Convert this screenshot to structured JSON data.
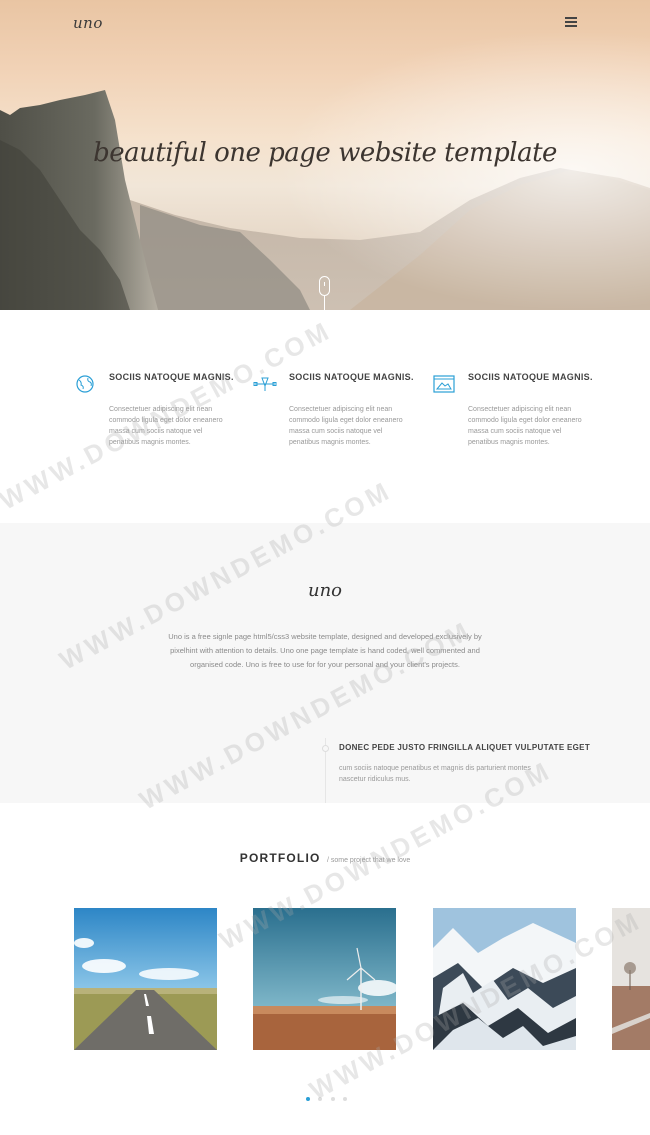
{
  "header": {
    "logo": "uno",
    "menu_icon": "hamburger-menu-icon"
  },
  "hero": {
    "title": "beautiful one page website template",
    "scroll_icon": "mouse-scroll-icon"
  },
  "features": [
    {
      "icon": "globe-icon",
      "title": "SOCIIS NATOQUE MAGNIS.",
      "text": "Consectetuer adipiscing elit nean commodo ligula eget dolor eneanero massa cum sociis natoque vel penatibus magnis montes."
    },
    {
      "icon": "vector-pen-icon",
      "title": "SOCIIS NATOQUE MAGNIS.",
      "text": "Consectetuer adipiscing elit nean commodo ligula eget dolor eneanero massa cum sociis natoque vel penatibus magnis montes."
    },
    {
      "icon": "browser-image-icon",
      "title": "SOCIIS NATOQUE MAGNIS.",
      "text": "Consectetuer adipiscing elit nean commodo ligula eget dolor eneanero massa cum sociis natoque vel penatibus magnis montes."
    }
  ],
  "about": {
    "logo": "uno",
    "text": "Uno is a free signle page html5/css3 website template, designed and developed exclusively by pixelhint with attention to details. Uno one page template is hand coded, well commented and organised code. Uno is free to use for for your personal and your client's projects.",
    "timeline": {
      "title": "DONEC PEDE JUSTO FRINGILLA ALIQUET VULPUTATE EGET",
      "text": "cum sociis natoque penatibus et magnis dis parturient montes nascetur ridiculus mus."
    }
  },
  "portfolio": {
    "title": "PORTFOLIO",
    "subtitle": "/ some project that we love",
    "items": [
      {
        "name": "road"
      },
      {
        "name": "windmill"
      },
      {
        "name": "snowy-mountains"
      },
      {
        "name": "field"
      }
    ],
    "active_slide": 1,
    "slide_count": 4
  },
  "watermark": "WWW.DOWNDEMO.COM"
}
